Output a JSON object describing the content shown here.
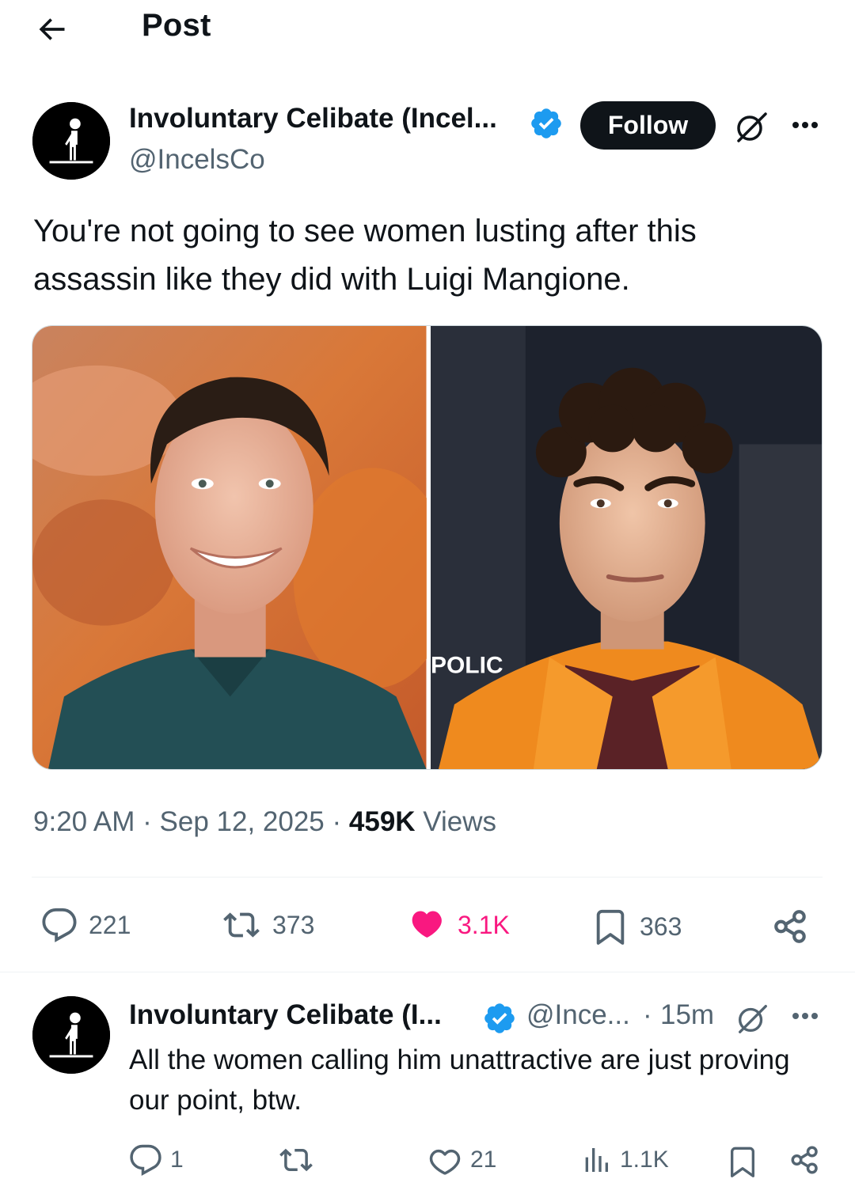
{
  "header": {
    "title": "Post"
  },
  "post": {
    "author_name": "Involuntary Celibate (Incel...",
    "author_handle": "@IncelsCo",
    "follow_label": "Follow",
    "text": "You're not going to see women lusting after this assassin like they did with Luigi Mangione.",
    "media": {
      "police_text": "POLIC"
    },
    "time": "9:20 AM",
    "separator": " · ",
    "date": "Sep 12, 2025",
    "views_count": "459K",
    "views_label": "Views",
    "stats": {
      "replies": "221",
      "reposts": "373",
      "likes": "3.1K",
      "bookmarks": "363"
    },
    "colors": {
      "like": "#f91880",
      "verified": "#1d9bf0",
      "text": "#0f1419",
      "secondary": "#536471"
    }
  },
  "reply": {
    "author_name": "Involuntary Celibate (I...",
    "author_handle": "@Ince...",
    "separator": "·",
    "time": "15m",
    "text": "All the women calling him unattractive are just proving our point, btw.",
    "stats": {
      "replies": "1",
      "likes": "21",
      "views": "1.1K"
    }
  },
  "icons": {
    "back": "arrow-left-icon",
    "verified": "verified-badge-icon",
    "grok": "grok-icon",
    "more": "more-horizontal-icon",
    "reply": "reply-bubble-icon",
    "repost": "repost-icon",
    "like": "heart-icon",
    "bookmark": "bookmark-icon",
    "share": "share-icon",
    "views": "views-bar-icon"
  }
}
